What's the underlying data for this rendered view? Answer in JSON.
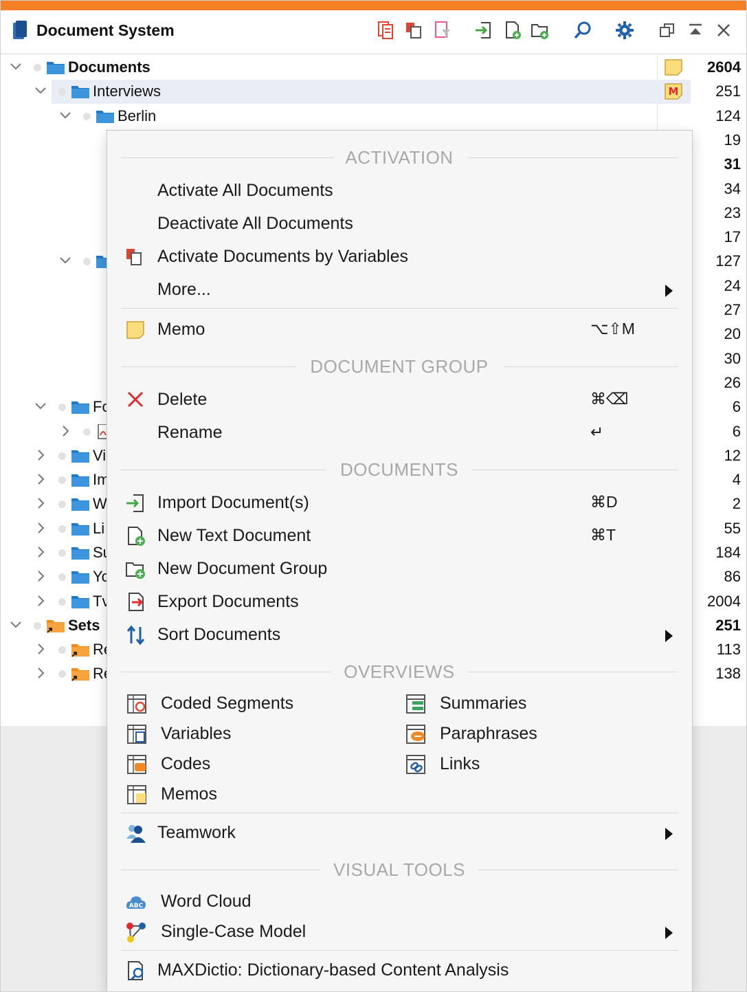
{
  "window": {
    "title": "Document System",
    "accent_color": "#f58025"
  },
  "tree": {
    "rows": [
      {
        "label": "Documents",
        "count": "2604"
      },
      {
        "label": "Interviews",
        "count": "251"
      },
      {
        "label": "Berlin",
        "count": "124"
      },
      {
        "count": "19"
      },
      {
        "count": "31"
      },
      {
        "count": "34"
      },
      {
        "count": "23"
      },
      {
        "count": "17"
      },
      {
        "count": "127"
      },
      {
        "count": "24"
      },
      {
        "count": "27"
      },
      {
        "count": "20"
      },
      {
        "count": "30"
      },
      {
        "count": "26"
      },
      {
        "label": "Fo",
        "count": "6"
      },
      {
        "count": "6"
      },
      {
        "label": "Vi",
        "count": "12"
      },
      {
        "label": "Im",
        "count": "4"
      },
      {
        "label": "W",
        "count": "2"
      },
      {
        "label": "Li",
        "count": "55"
      },
      {
        "label": "Su",
        "count": "184"
      },
      {
        "label": "Yo",
        "count": "86"
      },
      {
        "label": "Tv",
        "count": "2004"
      },
      {
        "label": "Sets",
        "count": "251"
      },
      {
        "label": "Re",
        "count": "113"
      },
      {
        "label": "Re",
        "count": "138"
      }
    ],
    "memo_badge": "M"
  },
  "menu": {
    "sections": {
      "activation": "ACTIVATION",
      "document_group": "DOCUMENT GROUP",
      "documents": "DOCUMENTS",
      "overviews": "OVERVIEWS",
      "visual_tools": "VISUAL TOOLS"
    },
    "items": {
      "activate_all": "Activate All Documents",
      "deactivate_all": "Deactivate All Documents",
      "activate_by_vars": "Activate Documents by Variables",
      "more": "More...",
      "memo": "Memo",
      "memo_shortcut": "⌥⇧M",
      "delete": "Delete",
      "delete_shortcut": "⌘⌫",
      "rename": "Rename",
      "rename_shortcut": "↵",
      "import": "Import Document(s)",
      "import_shortcut": "⌘D",
      "new_text": "New Text Document",
      "new_text_shortcut": "⌘T",
      "new_group": "New Document Group",
      "export": "Export Documents",
      "sort": "Sort Documents",
      "teamwork": "Teamwork",
      "word_cloud": "Word Cloud",
      "single_case": "Single-Case Model",
      "maxdictio": "MAXDictio: Dictionary-based Content Analysis"
    },
    "overviews": {
      "coded_segments": "Coded Segments",
      "variables": "Variables",
      "codes": "Codes",
      "memos": "Memos",
      "summaries": "Summaries",
      "paraphrases": "Paraphrases",
      "links": "Links"
    }
  }
}
